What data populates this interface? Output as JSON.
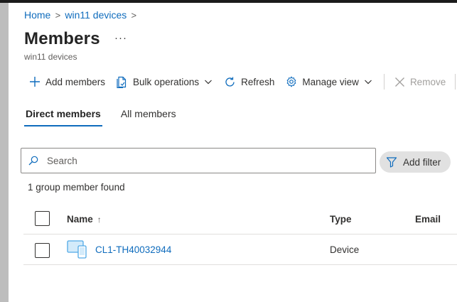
{
  "breadcrumb": [
    {
      "label": "Home"
    },
    {
      "label": "win11 devices"
    }
  ],
  "page": {
    "title": "Members",
    "more": "···",
    "subtitle": "win11 devices"
  },
  "toolbar": {
    "add_members": "Add members",
    "bulk_operations": "Bulk operations",
    "refresh": "Refresh",
    "manage_view": "Manage view",
    "remove": "Remove"
  },
  "tabs": [
    {
      "label": "Direct members",
      "active": true
    },
    {
      "label": "All members",
      "active": false
    }
  ],
  "search": {
    "placeholder": "Search",
    "value": ""
  },
  "filter": {
    "label": "Add filter"
  },
  "result_count": "1 group member found",
  "table": {
    "columns": {
      "name": "Name",
      "sort_indicator": "↑",
      "type": "Type",
      "email": "Email"
    },
    "rows": [
      {
        "name": "CL1-TH40032944",
        "type": "Device",
        "email": "",
        "icon": "device-icon"
      }
    ]
  },
  "colors": {
    "accent": "#0f6cbd",
    "icon_blue": "#50a9e6"
  }
}
